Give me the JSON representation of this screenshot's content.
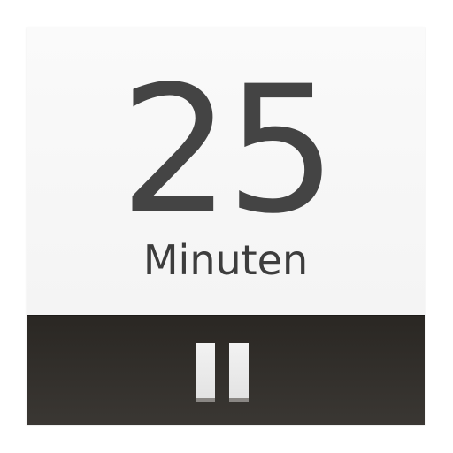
{
  "timer": {
    "value": "25",
    "unit_label": "Minuten"
  },
  "controls": {
    "pause_icon": "pause-icon"
  },
  "colors": {
    "panel_background": "#f7f7f7",
    "text": "#444444",
    "control_bar": "#32302c",
    "icon": "#ececec"
  }
}
